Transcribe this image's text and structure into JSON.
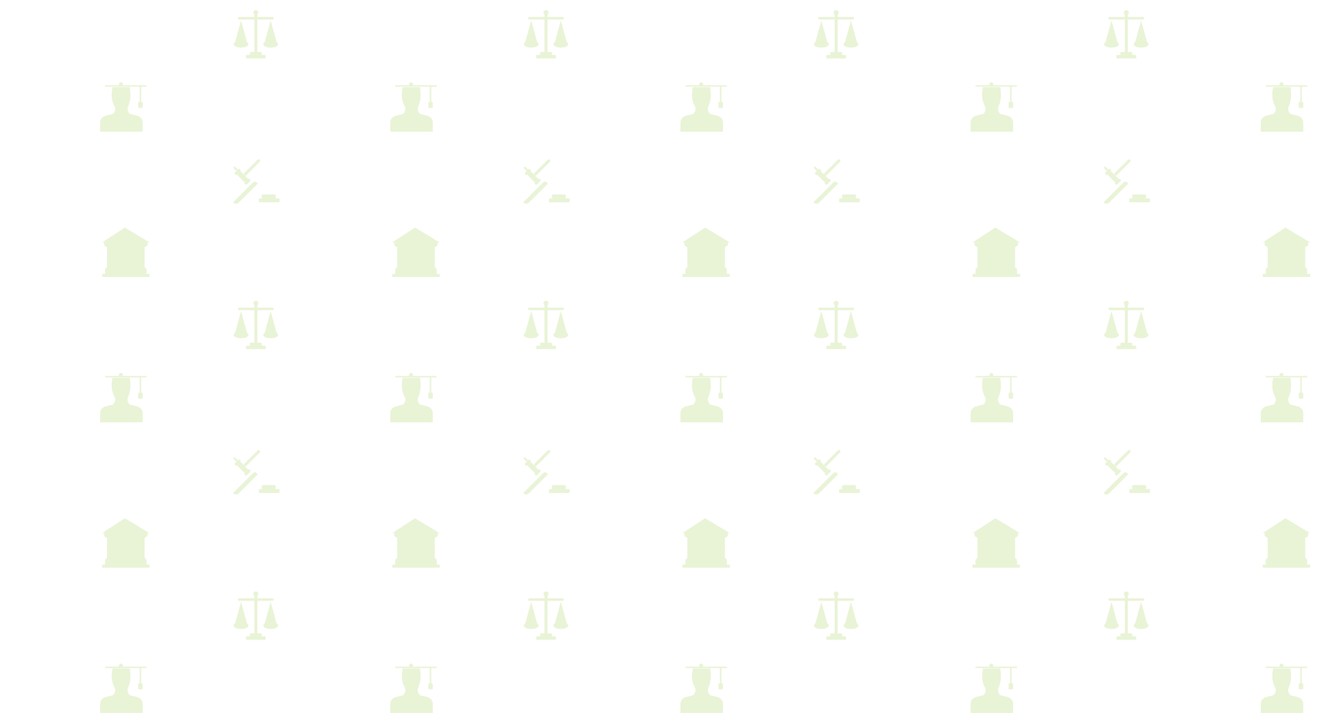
{
  "background": {
    "color": "#ffffff",
    "motif_color": "#e9f3d6"
  },
  "pattern": {
    "icons": [
      "scales-of-justice-icon",
      "graduate-person-icon",
      "gavel-icon",
      "courthouse-icon"
    ],
    "rows": [
      {
        "icon": "scales-of-justice-icon",
        "count": 4
      },
      {
        "icon": "graduate-person-icon",
        "count": 5
      },
      {
        "icon": "gavel-icon",
        "count": 4
      },
      {
        "icon": "courthouse-icon",
        "count": 5
      },
      {
        "icon": "scales-of-justice-icon",
        "count": 4
      },
      {
        "icon": "graduate-person-icon",
        "count": 5
      },
      {
        "icon": "gavel-icon",
        "count": 4
      },
      {
        "icon": "courthouse-icon",
        "count": 5
      },
      {
        "icon": "scales-of-justice-icon",
        "count": 4
      },
      {
        "icon": "graduate-person-icon",
        "count": 5
      }
    ]
  }
}
